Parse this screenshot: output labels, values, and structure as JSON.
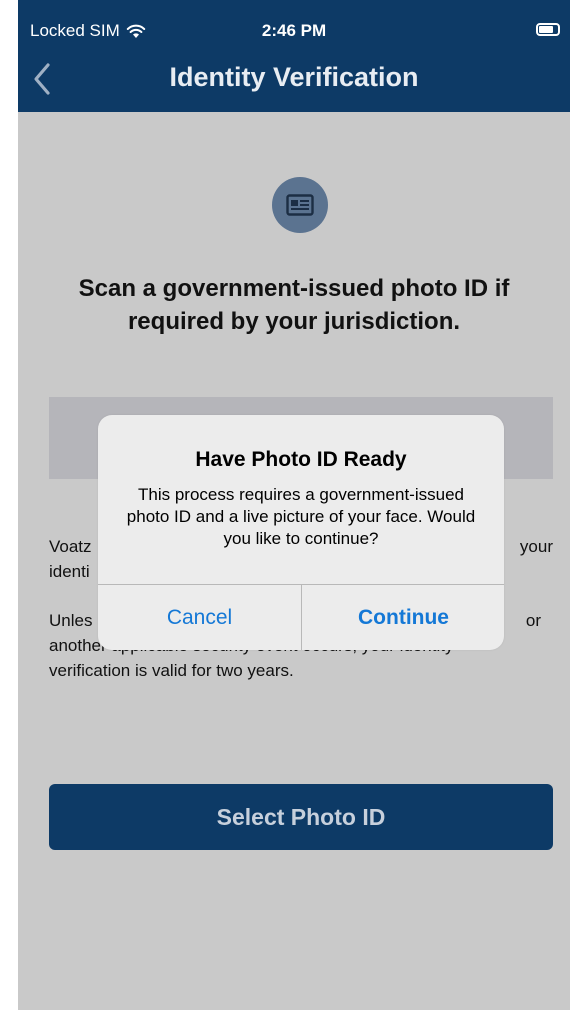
{
  "status_bar": {
    "carrier": "Locked SIM",
    "time": "2:46 PM",
    "icons": [
      "wifi-icon",
      "battery-icon"
    ]
  },
  "nav": {
    "title": "Identity Verification",
    "back_icon": "chevron-left-icon"
  },
  "main": {
    "icon": "id-card-icon",
    "heading": "Scan a government-issued photo ID if required by your jurisdiction.",
    "paragraph1_left": "Voatz",
    "paragraph1_line2": "identi",
    "paragraph1_right": "your",
    "paragraph2_left": "Unles",
    "paragraph2_right": "or",
    "paragraph2_line2": "another applicable security event occurs, your identity",
    "paragraph2_line3": "verification is valid for two years.",
    "select_button": "Select Photo ID"
  },
  "alert": {
    "title": "Have Photo ID Ready",
    "message": "This process requires a government-issued photo ID and a live picture of your face. Would you like to continue?",
    "cancel": "Cancel",
    "continue": "Continue"
  },
  "colors": {
    "header": "#0d3a66",
    "background_dimmed": "#c9c9c9",
    "alert_button_text": "#1478d6",
    "icon_circle": "#5b7390"
  }
}
